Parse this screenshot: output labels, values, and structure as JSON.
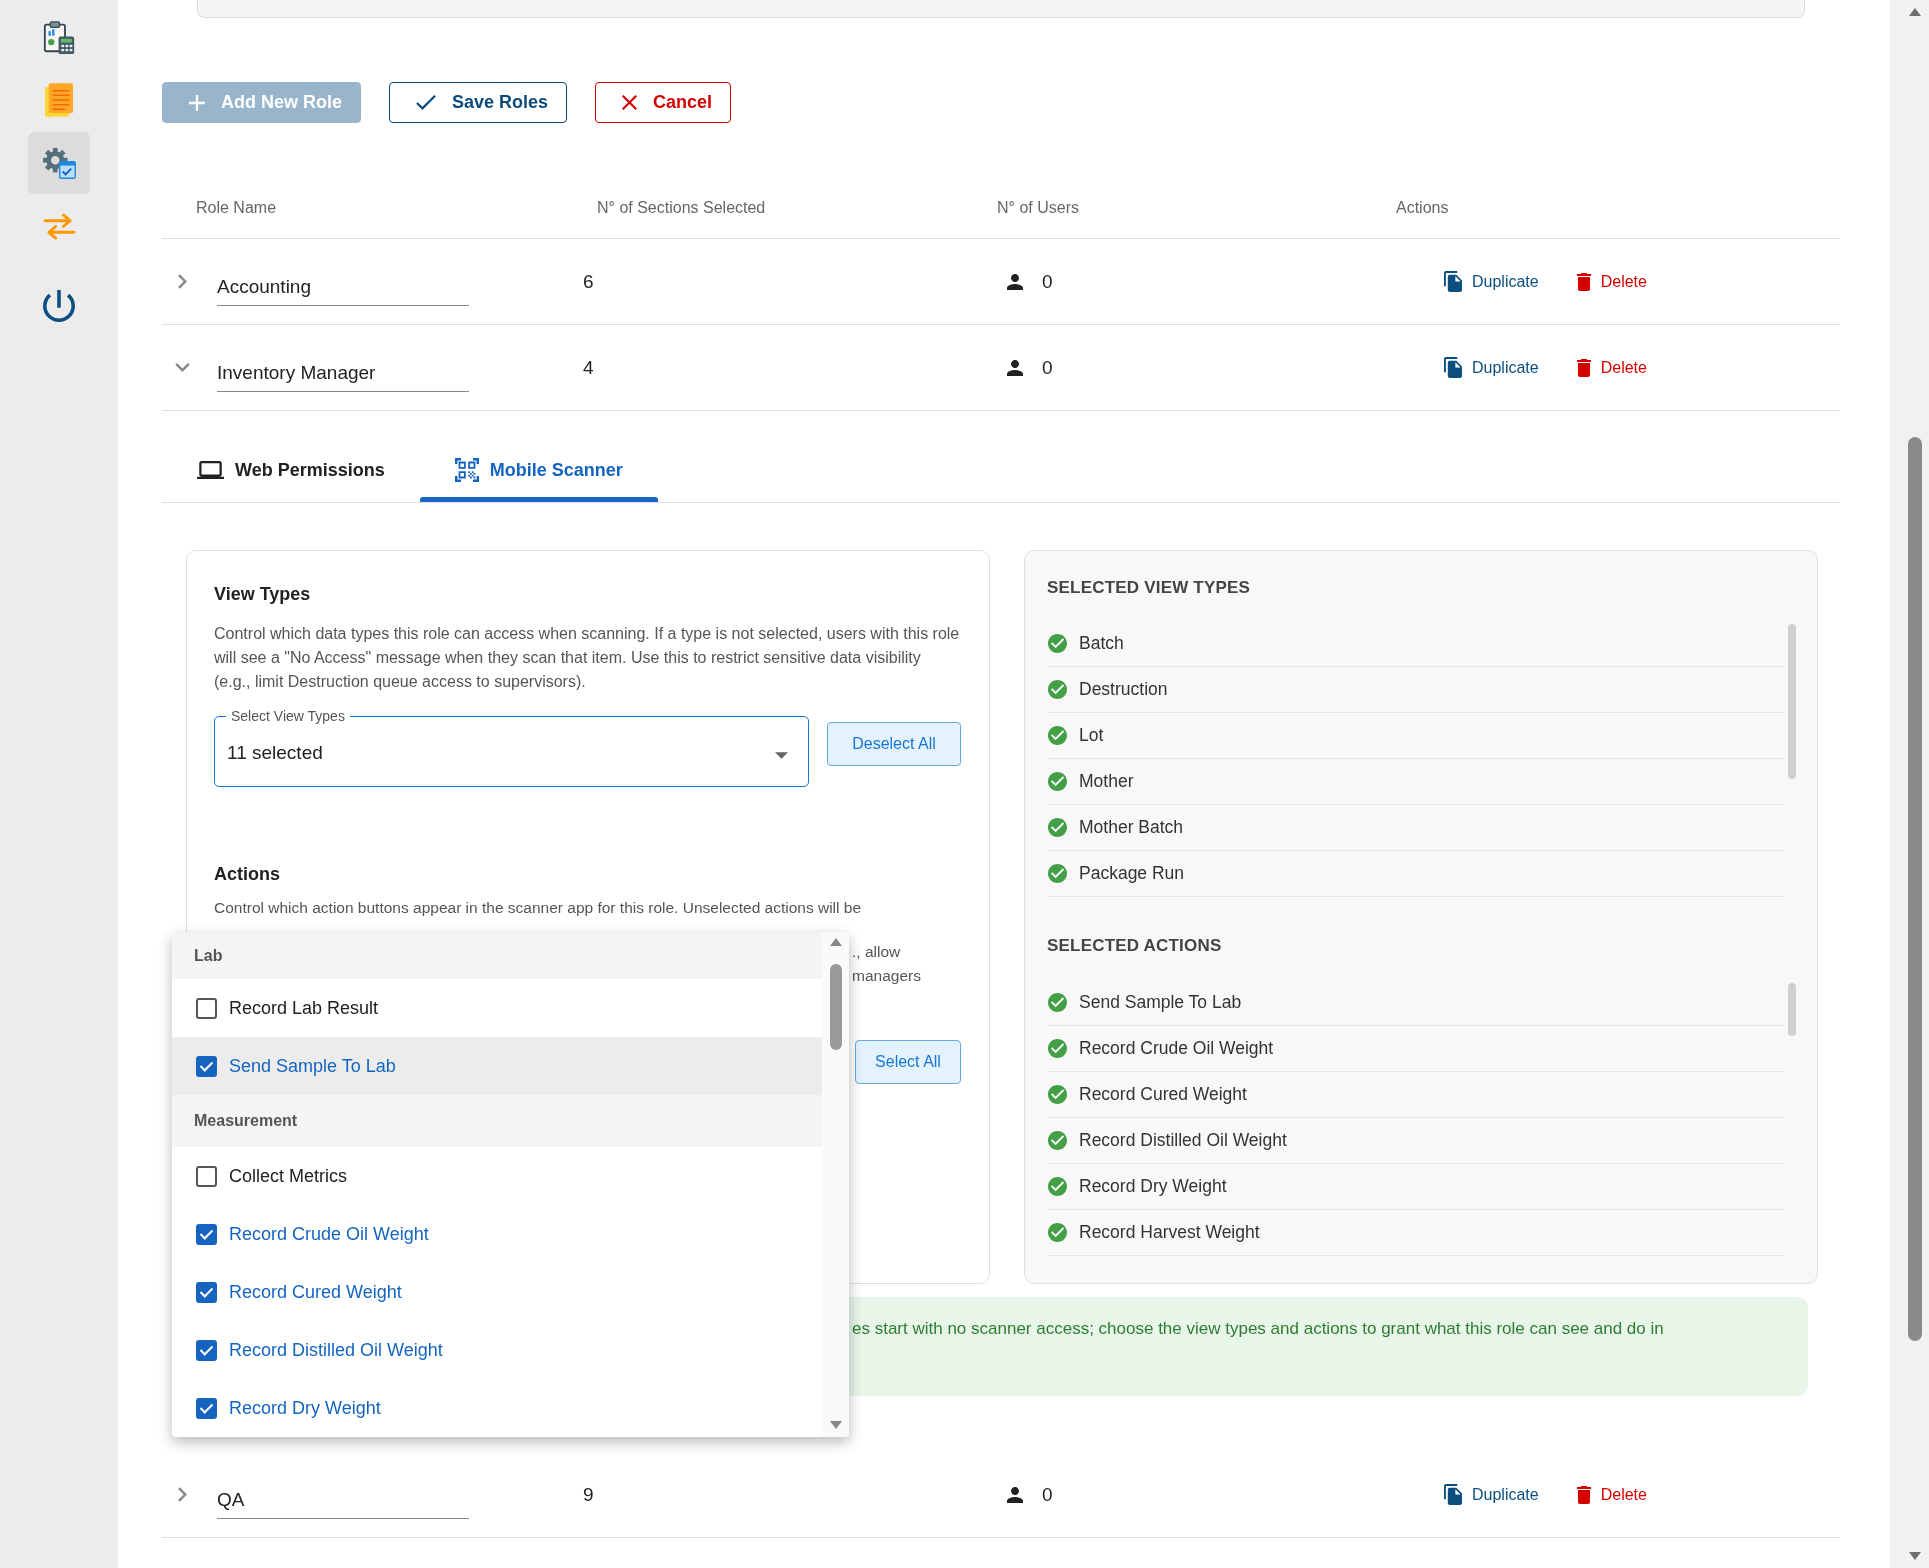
{
  "sidebar": {
    "items": [
      {
        "kind": "reports",
        "selected": false
      },
      {
        "kind": "notes",
        "selected": false
      },
      {
        "kind": "settings",
        "selected": true
      },
      {
        "kind": "transfer",
        "selected": false
      },
      {
        "kind": "power",
        "selected": false
      }
    ]
  },
  "toolbar": {
    "buttons": [
      {
        "kind": "add",
        "label": "Add New Role",
        "disabled": true
      },
      {
        "kind": "save",
        "label": "Save Roles",
        "disabled": false
      },
      {
        "kind": "cancel",
        "label": "Cancel",
        "disabled": false
      }
    ]
  },
  "table": {
    "columns": [
      "Role Name",
      "N° of Sections Selected",
      "N° of Users",
      "Actions"
    ],
    "rows": [
      {
        "name": "Accounting",
        "sections": "6",
        "users": "0",
        "expanded": false,
        "actions": [
          {
            "kind": "duplicate",
            "label": "Duplicate"
          },
          {
            "kind": "delete",
            "label": "Delete"
          }
        ]
      },
      {
        "name": "Inventory Manager",
        "sections": "4",
        "users": "0",
        "expanded": true,
        "actions": [
          {
            "kind": "duplicate",
            "label": "Duplicate"
          },
          {
            "kind": "delete",
            "label": "Delete"
          }
        ],
        "details": {
          "tabs": [
            {
              "kind": "web",
              "label": "Web Permissions",
              "selected": false
            },
            {
              "kind": "scanner",
              "label": "Mobile Scanner",
              "selected": true
            }
          ],
          "view_types": {
            "title": "View Types",
            "description": "Control which data types this role can access when scanning. If a type is not selected, users with this role will see a \"No Access\" message when they scan that item. Use this to restrict sensitive data visibility (e.g., limit Destruction queue access to supervisors).",
            "select": {
              "label": "Select View Types",
              "value": "11 selected"
            },
            "button": "Deselect All"
          },
          "actions": {
            "title": "Actions",
            "description": "Control which action buttons appear in the scanner app for this role. Unselected actions will be",
            "description_fragments": [
              "., allow",
              "managers"
            ],
            "button": "Select All",
            "menu": {
              "groups": [
                {
                  "label": "Lab",
                  "options": [
                    {
                      "label": "Record Lab Result",
                      "checked": false,
                      "highlighted": false
                    },
                    {
                      "label": "Send Sample To Lab",
                      "checked": true,
                      "highlighted": true
                    }
                  ]
                },
                {
                  "label": "Measurement",
                  "options": [
                    {
                      "label": "Collect Metrics",
                      "checked": false,
                      "highlighted": false
                    },
                    {
                      "label": "Record Crude Oil Weight",
                      "checked": true,
                      "highlighted": false
                    },
                    {
                      "label": "Record Cured Weight",
                      "checked": true,
                      "highlighted": false
                    },
                    {
                      "label": "Record Distilled Oil Weight",
                      "checked": true,
                      "highlighted": false
                    },
                    {
                      "label": "Record Dry Weight",
                      "checked": true,
                      "highlighted": false
                    }
                  ]
                }
              ]
            }
          },
          "summary": [
            {
              "title": "SELECTED VIEW TYPES",
              "items": [
                "Batch",
                "Destruction",
                "Lot",
                "Mother",
                "Mother Batch",
                "Package Run"
              ]
            },
            {
              "title": "SELECTED ACTIONS",
              "items": [
                "Send Sample To Lab",
                "Record Crude Oil Weight",
                "Record Cured Weight",
                "Record Distilled Oil Weight",
                "Record Dry Weight",
                "Record Harvest Weight"
              ]
            }
          ],
          "banner": {
            "text": "es start with no scanner access; choose the view types and actions to grant what this role can see and do in"
          }
        }
      },
      {
        "name": "QA",
        "sections": "9",
        "users": "0",
        "expanded": false,
        "actions": [
          {
            "kind": "duplicate",
            "label": "Duplicate"
          },
          {
            "kind": "delete",
            "label": "Delete"
          }
        ]
      }
    ]
  }
}
